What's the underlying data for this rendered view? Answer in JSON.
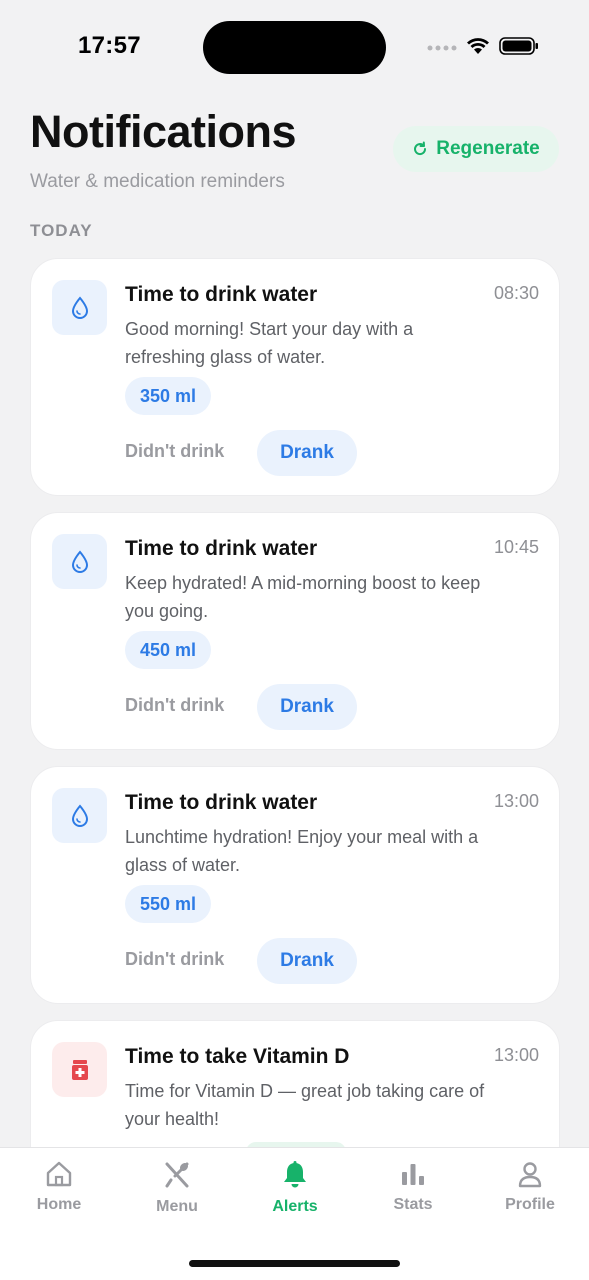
{
  "status": {
    "time": "17:57"
  },
  "header": {
    "title": "Notifications",
    "subtitle": "Water & medication reminders",
    "regenerate_label": "Regenerate"
  },
  "section": {
    "label": "TODAY"
  },
  "cards": [
    {
      "type": "water",
      "icon": "water-drop-icon",
      "title": "Time to drink water",
      "time": "08:30",
      "message": "Good morning! Start your day with a refreshing glass of water.",
      "amount": "350 ml",
      "skip_label": "Didn't drink",
      "done_label": "Drank"
    },
    {
      "type": "water",
      "icon": "water-drop-icon",
      "title": "Time to drink water",
      "time": "10:45",
      "message": "Keep hydrated! A mid-morning boost to keep you going.",
      "amount": "450 ml",
      "skip_label": "Didn't drink",
      "done_label": "Drank"
    },
    {
      "type": "water",
      "icon": "water-drop-icon",
      "title": "Time to drink water",
      "time": "13:00",
      "message": "Lunchtime hydration! Enjoy your meal with a glass of water.",
      "amount": "550 ml",
      "skip_label": "Didn't drink",
      "done_label": "Drank"
    },
    {
      "type": "medication",
      "icon": "medicine-icon",
      "title": "Time to take Vitamin D",
      "time": "13:00",
      "message": "Time for Vitamin D — great job taking care of your health!"
    }
  ],
  "tabs": [
    {
      "label": "Home",
      "icon": "home-icon",
      "active": false
    },
    {
      "label": "Menu",
      "icon": "utensils-icon",
      "active": false
    },
    {
      "label": "Alerts",
      "icon": "bell-icon",
      "active": true
    },
    {
      "label": "Stats",
      "icon": "bar-chart-icon",
      "active": false
    },
    {
      "label": "Profile",
      "icon": "user-icon",
      "active": false
    }
  ],
  "colors": {
    "accent_green": "#17b26a",
    "accent_blue": "#2d7be5",
    "medication_red": "#e5484d",
    "background": "#f2f2f3"
  }
}
